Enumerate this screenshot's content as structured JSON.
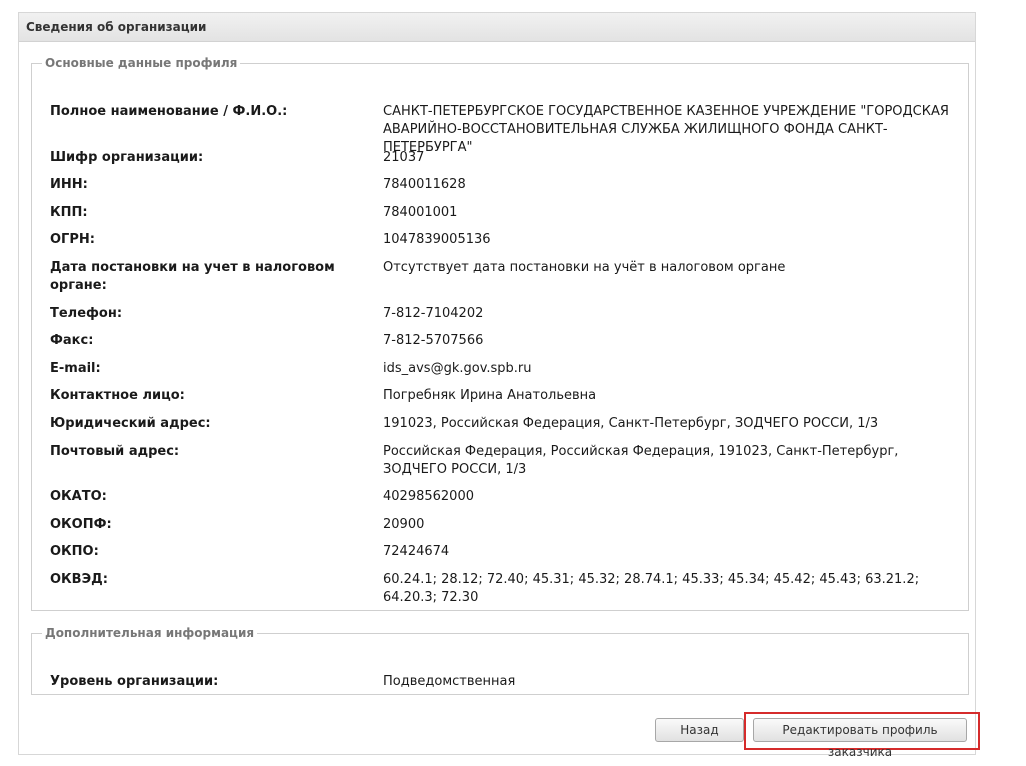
{
  "panel": {
    "title": "Сведения об организации"
  },
  "main_section": {
    "legend": "Основные данные профиля",
    "fields": [
      {
        "label": "Полное наименование / Ф.И.О.:",
        "value": "САНКТ-ПЕТЕРБУРГСКОЕ ГОСУДАРСТВЕННОЕ КАЗЕННОЕ УЧРЕЖДЕНИЕ \"ГОРОДСКАЯ АВАРИЙНО-ВОССТАНОВИТЕЛЬНАЯ СЛУЖБА ЖИЛИЩНОГО ФОНДА САНКТ-ПЕТЕРБУРГА\""
      },
      {
        "label": "Шифр организации:",
        "value": "21037"
      },
      {
        "label": "ИНН:",
        "value": "7840011628"
      },
      {
        "label": "КПП:",
        "value": "784001001"
      },
      {
        "label": "ОГРН:",
        "value": "1047839005136"
      },
      {
        "label": "Дата постановки на учет в налоговом органе:",
        "value": "Отсутствует дата постановки на учёт в налоговом органе"
      },
      {
        "label": "Телефон:",
        "value": "7-812-7104202"
      },
      {
        "label": "Факс:",
        "value": "7-812-5707566"
      },
      {
        "label": "E-mail:",
        "value": "ids_avs@gk.gov.spb.ru"
      },
      {
        "label": "Контактное лицо:",
        "value": "Погребняк Ирина Анатольевна"
      },
      {
        "label": "Юридический адрес:",
        "value": "191023, Российская Федерация, Санкт-Петербург, ЗОДЧЕГО РОССИ, 1/3"
      },
      {
        "label": "Почтовый адрес:",
        "value": "Российская Федерация, Российская Федерация, 191023, Санкт-Петербург, ЗОДЧЕГО РОССИ, 1/3"
      },
      {
        "label": "ОКАТО:",
        "value": "40298562000"
      },
      {
        "label": "ОКОПФ:",
        "value": "20900"
      },
      {
        "label": "ОКПО:",
        "value": "72424674"
      },
      {
        "label": "ОКВЭД:",
        "value": "60.24.1; 28.12; 72.40; 45.31; 45.32; 28.74.1; 45.33; 45.34; 45.42; 45.43; 63.21.2; 64.20.3; 72.30"
      }
    ]
  },
  "extra_section": {
    "legend": "Дополнительная информация",
    "fields": [
      {
        "label": "Уровень организации:",
        "value": "Подведомственная"
      }
    ]
  },
  "buttons": {
    "back_label": "Назад",
    "edit_label": "Редактировать профиль заказчика"
  },
  "colors": {
    "highlight": "#d52b2b"
  }
}
